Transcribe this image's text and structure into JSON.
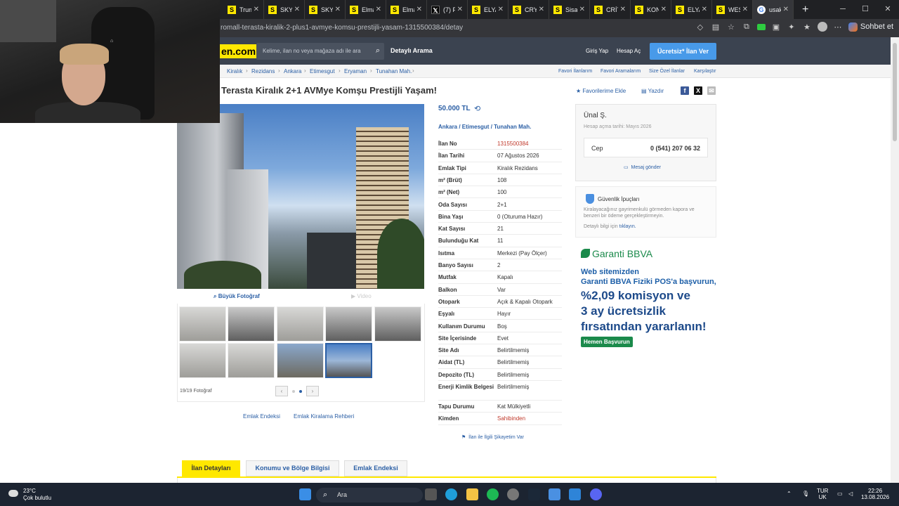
{
  "browser": {
    "tabs": [
      {
        "label": "Trum",
        "icon": "S",
        "kind": "s"
      },
      {
        "label": "SKYL",
        "icon": "S",
        "kind": "s"
      },
      {
        "label": "SKYL",
        "icon": "S",
        "kind": "s"
      },
      {
        "label": "Elma",
        "icon": "S",
        "kind": "s"
      },
      {
        "label": "Elma",
        "icon": "S",
        "kind": "s"
      },
      {
        "label": "(7) Po",
        "icon": "𝕏",
        "kind": "x"
      },
      {
        "label": "ELYA",
        "icon": "S",
        "kind": "s"
      },
      {
        "label": "CRYS",
        "icon": "S",
        "kind": "s"
      },
      {
        "label": "Sisa",
        "icon": "S",
        "kind": "s"
      },
      {
        "label": "CRİTE",
        "icon": "S",
        "kind": "s"
      },
      {
        "label": "KON",
        "icon": "S",
        "kind": "s"
      },
      {
        "label": "ELYA",
        "icon": "S",
        "kind": "s"
      },
      {
        "label": "WEST",
        "icon": "S",
        "kind": "s"
      },
      {
        "label": "usak",
        "icon": "G",
        "kind": "g"
      }
    ],
    "url": "romall-terasta-kiralik-2-plus1-avmye-komsu-prestijli-yasam-1315500384/detay",
    "sohbet_label": "Sohbet et"
  },
  "header": {
    "logo_text": "en.com",
    "search_placeholder": "Kelime, ilan no veya mağaza adı ile ara",
    "advanced_search": "Detaylı Arama",
    "login": "Giriş Yap",
    "register": "Hesap Aç",
    "post_ad": "Ücretsiz* İlan Ver"
  },
  "breadcrumbs": [
    "Kiralık",
    "Rezidans",
    "Ankara",
    "Etimesgut",
    "Eryaman",
    "Tunahan Mah."
  ],
  "top_links": [
    "Favori İlanlarım",
    "Favori Aramalarım",
    "Size Özel İlanlar",
    "Karşılaştır"
  ],
  "listing": {
    "title": "Terasta Kiralık 2+1 AVMye Komşu Prestijli Yaşam!",
    "add_favorite": "Favorilerime Ekle",
    "print": "Yazdır",
    "price": "50.000 TL",
    "location": [
      "Ankara",
      "Etimesgut",
      "Tunahan Mah."
    ],
    "photo_tab": "Büyük Fotoğraf",
    "video_tab": "Video",
    "photo_count": "19/19 Fotoğraf",
    "sub_links": [
      "Emlak Endeksi",
      "Emlak Kiralama Rehberi"
    ],
    "complaint": "İlan ile İlgili Şikayetim Var"
  },
  "details": [
    {
      "label": "İlan No",
      "value": "1315500384",
      "red": true
    },
    {
      "label": "İlan Tarihi",
      "value": "07 Ağustos 2026"
    },
    {
      "label": "Emlak Tipi",
      "value": "Kiralık Rezidans"
    },
    {
      "label": "m² (Brüt)",
      "value": "108"
    },
    {
      "label": "m² (Net)",
      "value": "100"
    },
    {
      "label": "Oda Sayısı",
      "value": "2+1"
    },
    {
      "label": "Bina Yaşı",
      "value": "0 (Oturuma Hazır)"
    },
    {
      "label": "Kat Sayısı",
      "value": "21"
    },
    {
      "label": "Bulunduğu Kat",
      "value": "11"
    },
    {
      "label": "Isıtma",
      "value": "Merkezi (Pay Ölçer)"
    },
    {
      "label": "Banyo Sayısı",
      "value": "2"
    },
    {
      "label": "Mutfak",
      "value": "Kapalı"
    },
    {
      "label": "Balkon",
      "value": "Var"
    },
    {
      "label": "Otopark",
      "value": "Açık & Kapalı Otopark"
    },
    {
      "label": "Eşyalı",
      "value": "Hayır"
    },
    {
      "label": "Kullanım Durumu",
      "value": "Boş"
    },
    {
      "label": "Site İçerisinde",
      "value": "Evet"
    },
    {
      "label": "Site Adı",
      "value": "Belirtilmemiş"
    },
    {
      "label": "Aidat (TL)",
      "value": "Belirtilmemiş"
    },
    {
      "label": "Depozito (TL)",
      "value": "Belirtilmemiş"
    },
    {
      "label": "Enerji Kimlik Belgesi",
      "value": "Belirtilmemiş"
    },
    {
      "label": "Tapu Durumu",
      "value": "Kat Mülkiyetli"
    },
    {
      "label": "Kimden",
      "value": "Sahibinden",
      "red": true
    }
  ],
  "seller": {
    "name": "Ünal Ş.",
    "joined": "Hesap açma tarihi: Mayıs 2026",
    "phone_label": "Cep",
    "phone": "0 (541) 207 06 32",
    "message": "Mesaj gönder"
  },
  "safety": {
    "title": "Güvenlik İpuçları",
    "text": "Kiralayacağınız gayrimenkulü görmeden kapora ve benzeri bir ödeme gerçekleştirmeyin.",
    "more_prefix": "Detaylı bilgi için",
    "more_link": "tıklayın."
  },
  "ad": {
    "brand": "Garanti BBVA",
    "line1": "Web sitemizden",
    "line2": "Garanti BBVA Fiziki POS'a başvurun,",
    "big": [
      "%2,09 komisyon ve",
      "3 ay ücretsizlik",
      "fırsatından yararlanın!"
    ],
    "button": "Hemen Başvurun"
  },
  "bottom_tabs": [
    "İlan Detayları",
    "Konumu ve Bölge Bilgisi",
    "Emlak Endeksi"
  ],
  "taskbar": {
    "temp": "23°C",
    "weather": "Çok bulutlu",
    "search": "Ara",
    "lang1": "TUR",
    "lang2": "UK",
    "time": "22:26",
    "date": "13.08.2026"
  },
  "colors": {
    "brand_yellow": "#ffe800",
    "link_blue": "#2b5fa5",
    "header_bg": "#3b4350",
    "post_ad_blue": "#489ae9",
    "ad_green": "#1b8a4b"
  }
}
